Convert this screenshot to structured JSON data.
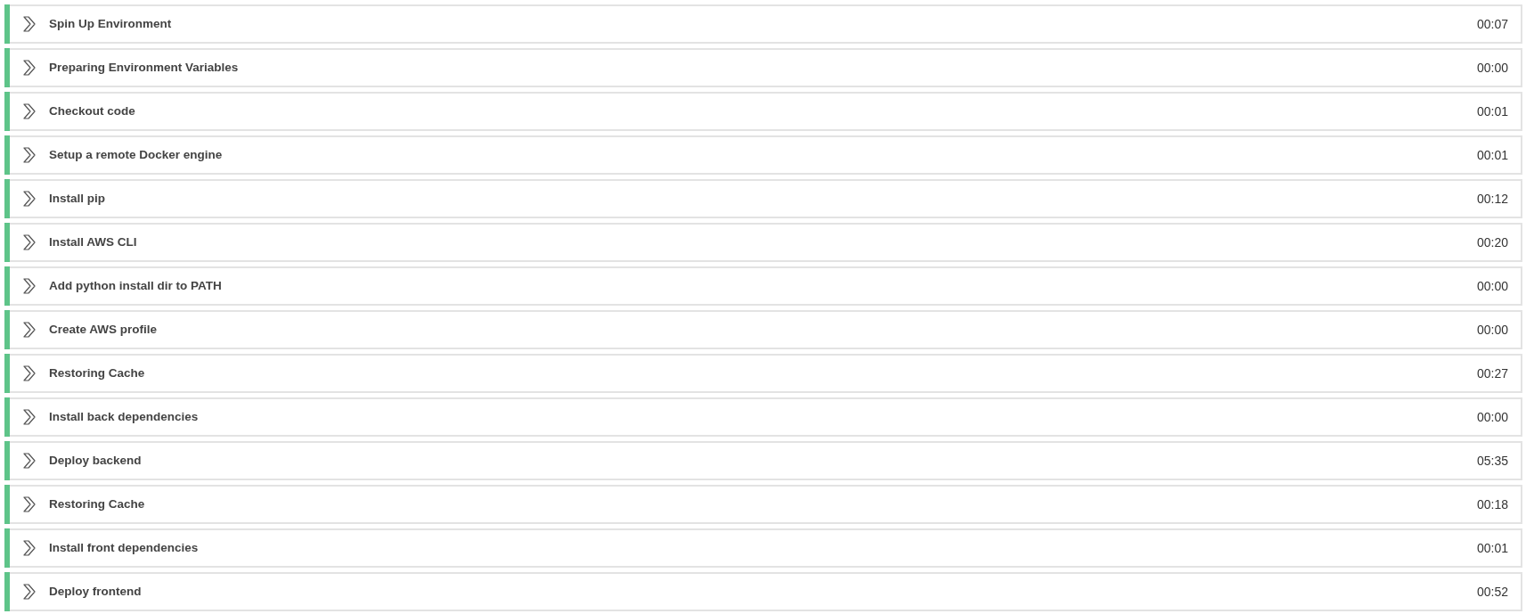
{
  "steps": [
    {
      "name": "Spin Up Environment",
      "duration": "00:07",
      "color": "#5ec489",
      "expanded": false
    },
    {
      "name": "Preparing Environment Variables",
      "duration": "00:00",
      "color": "#5ec489",
      "expanded": false
    },
    {
      "name": "Checkout code",
      "duration": "00:01",
      "color": "#5ec489",
      "expanded": false
    },
    {
      "name": "Setup a remote Docker engine",
      "duration": "00:01",
      "color": "#5ec489",
      "expanded": false
    },
    {
      "name": "Install pip",
      "duration": "00:12",
      "color": "#5ec489",
      "expanded": false
    },
    {
      "name": "Install AWS CLI",
      "duration": "00:20",
      "color": "#5ec489",
      "expanded": false
    },
    {
      "name": "Add python install dir to PATH",
      "duration": "00:00",
      "color": "#5ec489",
      "expanded": false
    },
    {
      "name": "Create AWS profile",
      "duration": "00:00",
      "color": "#5ec489",
      "expanded": false
    },
    {
      "name": "Restoring Cache",
      "duration": "00:27",
      "color": "#5ec489",
      "expanded": false
    },
    {
      "name": "Install back dependencies",
      "duration": "00:00",
      "color": "#5ec489",
      "expanded": false
    },
    {
      "name": "Deploy backend",
      "duration": "05:35",
      "color": "#5ec489",
      "expanded": false
    },
    {
      "name": "Restoring Cache",
      "duration": "00:18",
      "color": "#5ec489",
      "expanded": false
    },
    {
      "name": "Install front dependencies",
      "duration": "00:01",
      "color": "#5ec489",
      "expanded": false
    },
    {
      "name": "Deploy frontend",
      "duration": "00:52",
      "color": "#5ec489",
      "expanded": false
    }
  ]
}
